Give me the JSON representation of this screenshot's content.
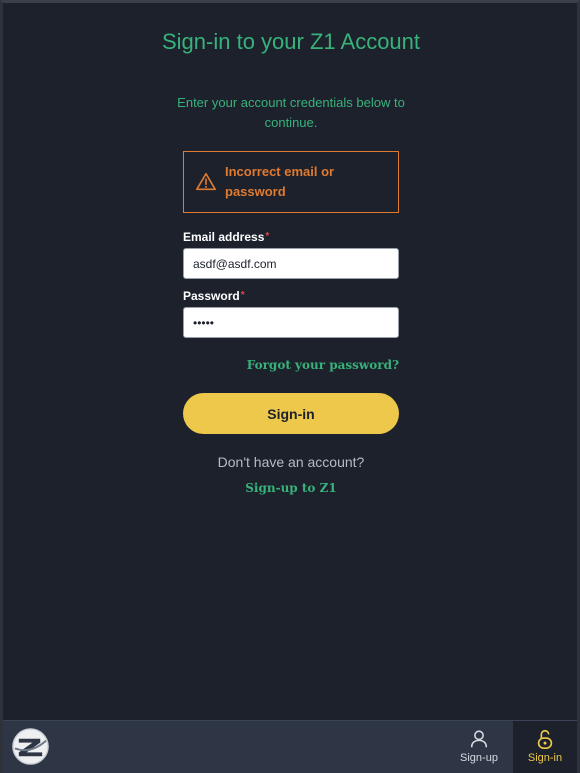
{
  "page": {
    "title": "Sign-in to your Z1 Account",
    "subtitle": "Enter your account credentials below to continue."
  },
  "alert": {
    "icon": "warning-triangle-icon",
    "message": "Incorrect email or password",
    "color": "#e07a2f"
  },
  "form": {
    "email_label": "Email address",
    "email_value": "asdf@asdf.com",
    "password_label": "Password",
    "password_value": "asdfg",
    "required_marker": "*",
    "forgot_link": "Forgot your password?",
    "submit_label": "Sign-in"
  },
  "signup_prompt": {
    "text": "Don't have an account?",
    "link": "Sign-up to Z1"
  },
  "bottom_nav": {
    "logo_icon": "z1-logo-icon",
    "items": [
      {
        "label": "Sign-up",
        "icon": "user-icon",
        "active": false
      },
      {
        "label": "Sign-in",
        "icon": "unlock-icon",
        "active": true
      }
    ]
  },
  "colors": {
    "background": "#1c212c",
    "accent_green": "#38b27a",
    "button_yellow": "#edc84a",
    "bottom_bar": "#2e3646"
  }
}
